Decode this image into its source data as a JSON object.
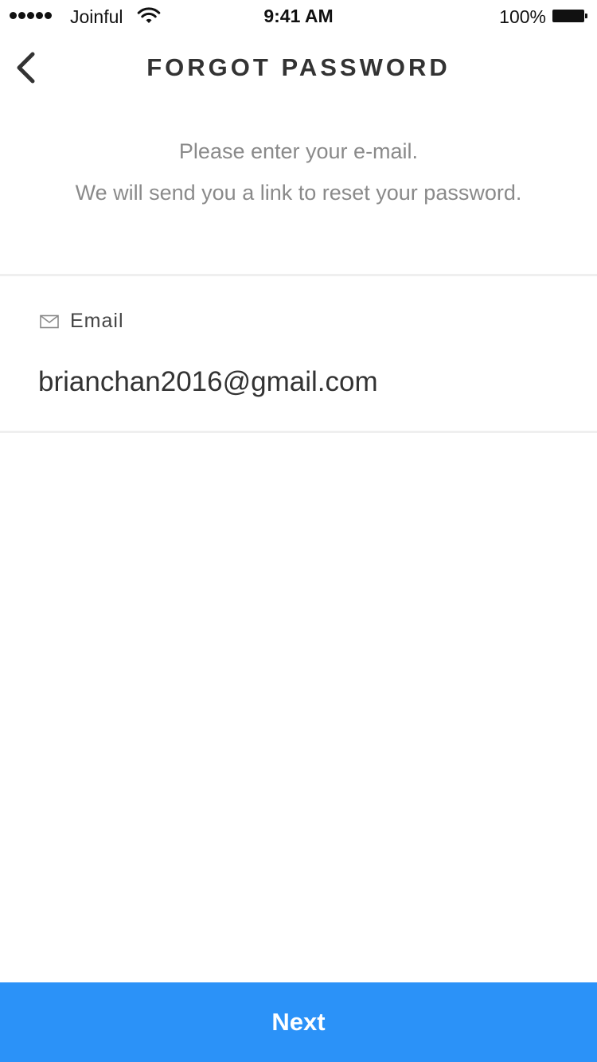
{
  "status_bar": {
    "carrier": "Joinful",
    "time": "9:41 AM",
    "battery_percent": "100%",
    "signal_bars": 5,
    "icons": [
      "signal-icon",
      "wifi-icon",
      "battery-icon"
    ]
  },
  "nav": {
    "title": "FORGOT PASSWORD",
    "back_icon": "chevron-left-icon"
  },
  "instructions": {
    "line1": "Please enter your e-mail.",
    "line2": "We will send you a link to reset your password."
  },
  "email_field": {
    "icon": "mail-icon",
    "label": "Email",
    "value": "brianchan2016@gmail.com"
  },
  "next_button": {
    "label": "Next"
  },
  "colors": {
    "accent": "#2b92f8",
    "instruction_text": "#8a8a8a",
    "divider": "#efefef",
    "title_text": "#333333"
  }
}
